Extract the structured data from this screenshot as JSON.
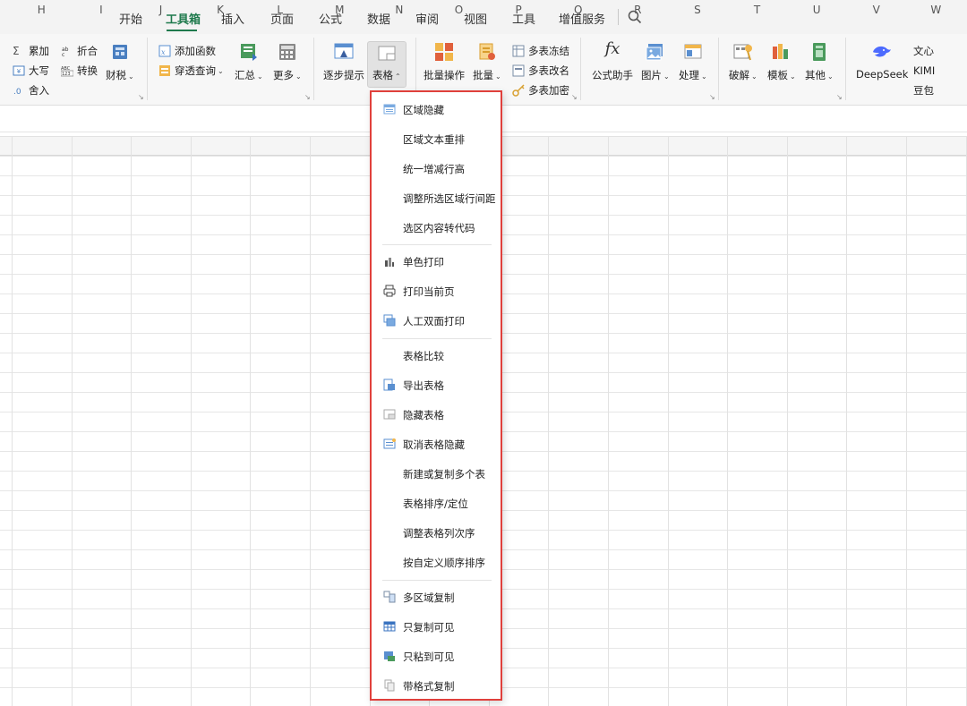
{
  "tabs": [
    {
      "label": "开始"
    },
    {
      "label": "工具箱"
    },
    {
      "label": "插入"
    },
    {
      "label": "页面"
    },
    {
      "label": "公式"
    },
    {
      "label": "数据"
    },
    {
      "label": "审阅"
    },
    {
      "label": "视图"
    },
    {
      "label": "工具"
    },
    {
      "label": "增值服务"
    }
  ],
  "active_tab": "工具箱",
  "ribbon": {
    "sum_label": "累加",
    "upper_label": "大写",
    "round_label": "舍入",
    "fold_label": "折合",
    "convert_label": "转换",
    "tax_label": "财税",
    "add_func_label": "添加函数",
    "lookup_label": "穿透查询",
    "summary_label": "汇总",
    "more_label": "更多",
    "step_hint_label": "逐步提示",
    "table_label": "表格",
    "batch_op_label": "批量操作",
    "batch_label": "批量",
    "multi_freeze_label": "多表冻结",
    "multi_rename_label": "多表改名",
    "multi_encrypt_label": "多表加密",
    "formula_helper_label": "公式助手",
    "picture_label": "图片",
    "process_label": "处理",
    "crack_label": "破解",
    "template_label": "模板",
    "other_label": "其他",
    "deepseek_label": "DeepSeek",
    "wenxin_label": "文心",
    "kimi_label": "KIMI",
    "doubao_label": "豆包"
  },
  "columns": [
    "H",
    "I",
    "J",
    "K",
    "L",
    "M",
    "N",
    "O",
    "P",
    "Q",
    "R",
    "S",
    "T",
    "U",
    "V",
    "W"
  ],
  "dropdown": {
    "items": [
      {
        "label": "区域隐藏"
      },
      {
        "label": "区域文本重排"
      },
      {
        "label": "统一增减行高"
      },
      {
        "label": "调整所选区域行间距"
      },
      {
        "label": "选区内容转代码"
      },
      {
        "label": "单色打印"
      },
      {
        "label": "打印当前页"
      },
      {
        "label": "人工双面打印"
      },
      {
        "label": "表格比较"
      },
      {
        "label": "导出表格"
      },
      {
        "label": "隐藏表格"
      },
      {
        "label": "取消表格隐藏"
      },
      {
        "label": "新建或复制多个表"
      },
      {
        "label": "表格排序/定位"
      },
      {
        "label": "调整表格列次序"
      },
      {
        "label": "按自定义顺序排序"
      },
      {
        "label": "多区域复制"
      },
      {
        "label": "只复制可见"
      },
      {
        "label": "只粘到可见"
      },
      {
        "label": "带格式复制"
      }
    ]
  },
  "colors": {
    "accent": "#1f7a4d",
    "highlight_border": "#e0403c"
  }
}
